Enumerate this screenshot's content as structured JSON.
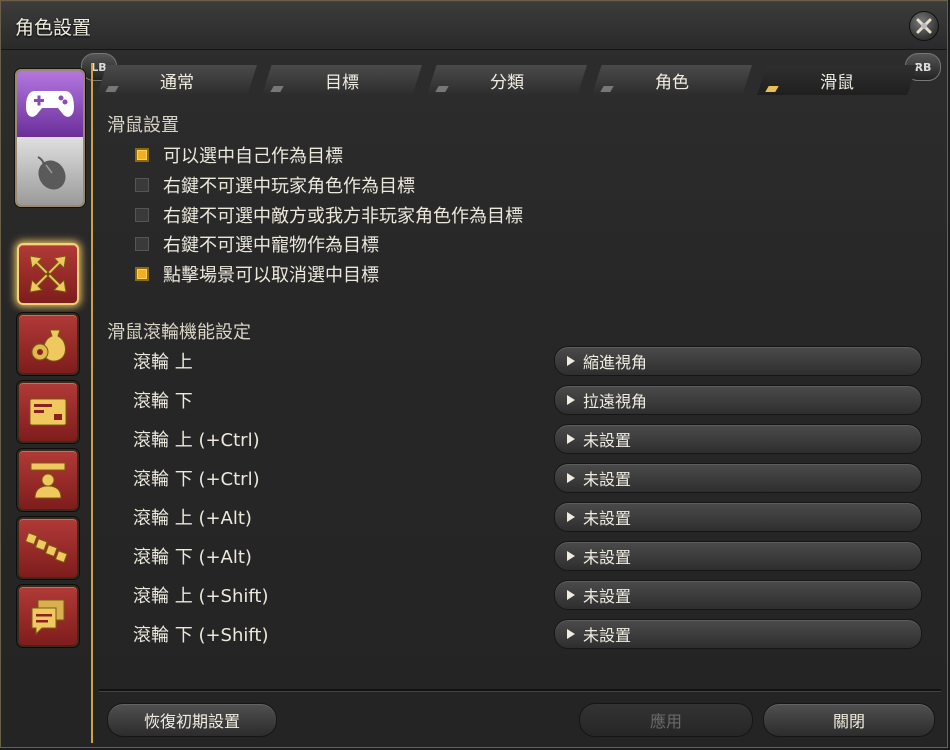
{
  "window": {
    "title": "角色設置"
  },
  "shoulder": {
    "left": "LB",
    "right": "RB"
  },
  "tabs": [
    {
      "label": "通常",
      "active": false
    },
    {
      "label": "目標",
      "active": false
    },
    {
      "label": "分類",
      "active": false
    },
    {
      "label": "角色",
      "active": false
    },
    {
      "label": "滑鼠",
      "active": true
    }
  ],
  "mouse_settings": {
    "heading": "滑鼠設置",
    "options": [
      {
        "label": "可以選中自己作為目標",
        "checked": true
      },
      {
        "label": "右鍵不可選中玩家角色作為目標",
        "checked": false
      },
      {
        "label": "右鍵不可選中敵方或我方非玩家角色作為目標",
        "checked": false
      },
      {
        "label": "右鍵不可選中寵物作為目標",
        "checked": false
      },
      {
        "label": "點擊場景可以取消選中目標",
        "checked": true
      }
    ]
  },
  "wheel_settings": {
    "heading": "滑鼠滾輪機能設定",
    "rows": [
      {
        "label": "滾輪 上",
        "value": "縮進視角"
      },
      {
        "label": "滾輪 下",
        "value": "拉遠視角"
      },
      {
        "label": "滾輪 上 (+Ctrl)",
        "value": "未設置"
      },
      {
        "label": "滾輪 下 (+Ctrl)",
        "value": "未設置"
      },
      {
        "label": "滾輪 上 (+Alt)",
        "value": "未設置"
      },
      {
        "label": "滾輪 下 (+Alt)",
        "value": "未設置"
      },
      {
        "label": "滾輪 上 (+Shift)",
        "value": "未設置"
      },
      {
        "label": "滾輪 下 (+Shift)",
        "value": "未設置"
      }
    ]
  },
  "footer": {
    "reset_label": "恢復初期設置",
    "apply_label": "應用",
    "close_label": "關閉"
  },
  "colors": {
    "accent_gold": "#c9a24a",
    "checkbox_on": "#f0b020",
    "category_red": "#b13a37"
  },
  "sidebar": {
    "mode_icons": [
      "gamepad-icon",
      "mouse-icon"
    ],
    "categories": [
      "target-arrows-icon",
      "bag-gear-icon",
      "card-icon",
      "character-icon",
      "chain-icon",
      "chat-icon"
    ]
  }
}
